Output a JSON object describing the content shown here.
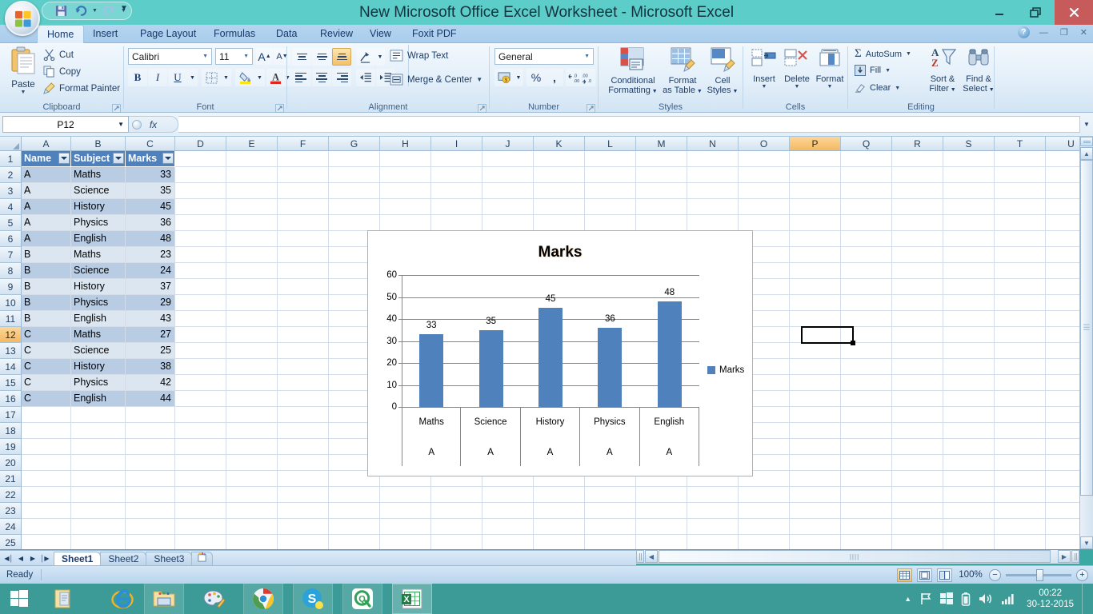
{
  "window": {
    "title": "New Microsoft Office Excel Worksheet - Microsoft Excel",
    "minimize": "—",
    "restore": "❐",
    "close": "✕"
  },
  "quick_access": {
    "save": "save-icon",
    "undo": "undo-icon",
    "redo": "redo-icon",
    "customize": "customize-icon"
  },
  "ribbon": {
    "tabs": [
      {
        "label": "Home",
        "active": true
      },
      {
        "label": "Insert",
        "active": false
      },
      {
        "label": "Page Layout",
        "active": false
      },
      {
        "label": "Formulas",
        "active": false
      },
      {
        "label": "Data",
        "active": false
      },
      {
        "label": "Review",
        "active": false
      },
      {
        "label": "View",
        "active": false
      },
      {
        "label": "Foxit PDF",
        "active": false
      }
    ],
    "help": "?",
    "ribbon_min": "—",
    "ribbon_restore": "❐",
    "ribbon_close": "✕",
    "groups": {
      "clipboard": {
        "label": "Clipboard",
        "paste": "Paste",
        "cut": "Cut",
        "copy": "Copy",
        "format_painter": "Format Painter"
      },
      "font": {
        "label": "Font",
        "font_name": "Calibri",
        "font_size": "11",
        "grow_font": "A",
        "shrink_font": "A",
        "bold": "B",
        "italic": "I",
        "underline": "U",
        "borders": "borders-icon",
        "fill_color": "fill-color-icon",
        "font_color": "A"
      },
      "alignment": {
        "label": "Alignment",
        "align_top": "align-top-icon",
        "align_middle": "align-middle-icon",
        "align_bottom": "align-bottom-icon",
        "orientation": "orientation-icon",
        "align_left": "align-left-icon",
        "align_center": "align-center-icon",
        "align_right": "align-right-icon",
        "decrease_indent": "decrease-indent-icon",
        "increase_indent": "increase-indent-icon",
        "wrap_text": "Wrap Text",
        "merge_center": "Merge & Center"
      },
      "number": {
        "label": "Number",
        "format": "General",
        "accounting": "accounting-format-icon",
        "percent": "%",
        "comma": ",",
        "increase_decimal": ".00",
        "decrease_decimal": ".00"
      },
      "styles": {
        "label": "Styles",
        "conditional_formatting": "Conditional\nFormatting",
        "conditional_formatting_l1": "Conditional",
        "conditional_formatting_l2": "Formatting",
        "format_as_table_l1": "Format",
        "format_as_table_l2": "as Table",
        "cell_styles_l1": "Cell",
        "cell_styles_l2": "Styles"
      },
      "cells": {
        "label": "Cells",
        "insert": "Insert",
        "delete": "Delete",
        "format": "Format"
      },
      "editing": {
        "label": "Editing",
        "autosum": "AutoSum",
        "fill": "Fill",
        "clear": "Clear",
        "sort_filter_l1": "Sort &",
        "sort_filter_l2": "Filter",
        "find_select_l1": "Find &",
        "find_select_l2": "Select"
      }
    }
  },
  "formula_bar": {
    "name_box": "P12",
    "formula": "",
    "fx": "fx"
  },
  "grid": {
    "columns": [
      "A",
      "B",
      "C",
      "D",
      "E",
      "F",
      "G",
      "H",
      "I",
      "J",
      "K",
      "L",
      "M",
      "N",
      "O",
      "P",
      "Q",
      "R",
      "S",
      "T",
      "U"
    ],
    "selected_column": "P",
    "selected_row": 12,
    "selected_cell": "P12",
    "rows": [
      1,
      2,
      3,
      4,
      5,
      6,
      7,
      8,
      9,
      10,
      11,
      12,
      13,
      14,
      15,
      16,
      17,
      18,
      19,
      20,
      21,
      22,
      23,
      24,
      25
    ],
    "table_headers": [
      "Name",
      "Subject",
      "Marks"
    ],
    "table_rows": [
      {
        "name": "A",
        "subject": "Maths",
        "marks": "33"
      },
      {
        "name": "A",
        "subject": "Science",
        "marks": "35"
      },
      {
        "name": "A",
        "subject": "History",
        "marks": "45"
      },
      {
        "name": "A",
        "subject": "Physics",
        "marks": "36"
      },
      {
        "name": "A",
        "subject": "English",
        "marks": "48"
      },
      {
        "name": "B",
        "subject": "Maths",
        "marks": "23"
      },
      {
        "name": "B",
        "subject": "Science",
        "marks": "24"
      },
      {
        "name": "B",
        "subject": "History",
        "marks": "37"
      },
      {
        "name": "B",
        "subject": "Physics",
        "marks": "29"
      },
      {
        "name": "B",
        "subject": "English",
        "marks": "43"
      },
      {
        "name": "C",
        "subject": "Maths",
        "marks": "27"
      },
      {
        "name": "C",
        "subject": "Science",
        "marks": "25"
      },
      {
        "name": "C",
        "subject": "History",
        "marks": "38"
      },
      {
        "name": "C",
        "subject": "Physics",
        "marks": "42"
      },
      {
        "name": "C",
        "subject": "English",
        "marks": "44"
      }
    ]
  },
  "chart_data": {
    "type": "bar",
    "title": "Marks",
    "categories": [
      "Maths",
      "Science",
      "History",
      "Physics",
      "English"
    ],
    "group_labels": [
      "A",
      "A",
      "A",
      "A",
      "A"
    ],
    "values": [
      33,
      35,
      45,
      36,
      48
    ],
    "data_labels": [
      "33",
      "35",
      "45",
      "36",
      "48"
    ],
    "series": [
      {
        "name": "Marks",
        "values": [
          33,
          35,
          45,
          36,
          48
        ]
      }
    ],
    "legend": {
      "entries": [
        "Marks"
      ],
      "position": "right"
    },
    "yticks": [
      0,
      10,
      20,
      30,
      40,
      50,
      60
    ],
    "ylim": [
      0,
      60
    ],
    "xlabel": "",
    "ylabel": "",
    "grid": true,
    "bar_color": "#4F81BD"
  },
  "sheet_tabs": {
    "first": "◀│",
    "prev": "◀",
    "next": "▶",
    "last": "│▶",
    "tabs": [
      {
        "label": "Sheet1",
        "active": true
      },
      {
        "label": "Sheet2",
        "active": false
      },
      {
        "label": "Sheet3",
        "active": false
      }
    ],
    "new_sheet": "new-sheet-icon"
  },
  "status_bar": {
    "state": "Ready",
    "view_normal": "normal-view-icon",
    "view_page_layout": "page-layout-view-icon",
    "view_page_break": "page-break-view-icon",
    "zoom": "100%",
    "zoom_out": "−",
    "zoom_in": "+"
  },
  "taskbar": {
    "start": "windows-start-icon",
    "items": [
      {
        "name": "documents-icon",
        "open": false
      },
      {
        "name": "internet-explorer-icon",
        "open": false
      },
      {
        "name": "file-explorer-icon",
        "open": true
      },
      {
        "name": "paint-icon",
        "open": false
      },
      {
        "name": "google-chrome-icon",
        "open": true
      },
      {
        "name": "skype-icon",
        "open": true
      },
      {
        "name": "quick-heal-icon",
        "open": true
      },
      {
        "name": "excel-icon",
        "open": true,
        "active": true
      }
    ],
    "tray": {
      "show_hidden": "▲",
      "flag": "flag-icon",
      "windows": "windows-icon",
      "battery": "battery-icon",
      "volume": "volume-icon",
      "network": "network-icon"
    },
    "clock_time": "00:22",
    "clock_date": "30-12-2015"
  }
}
